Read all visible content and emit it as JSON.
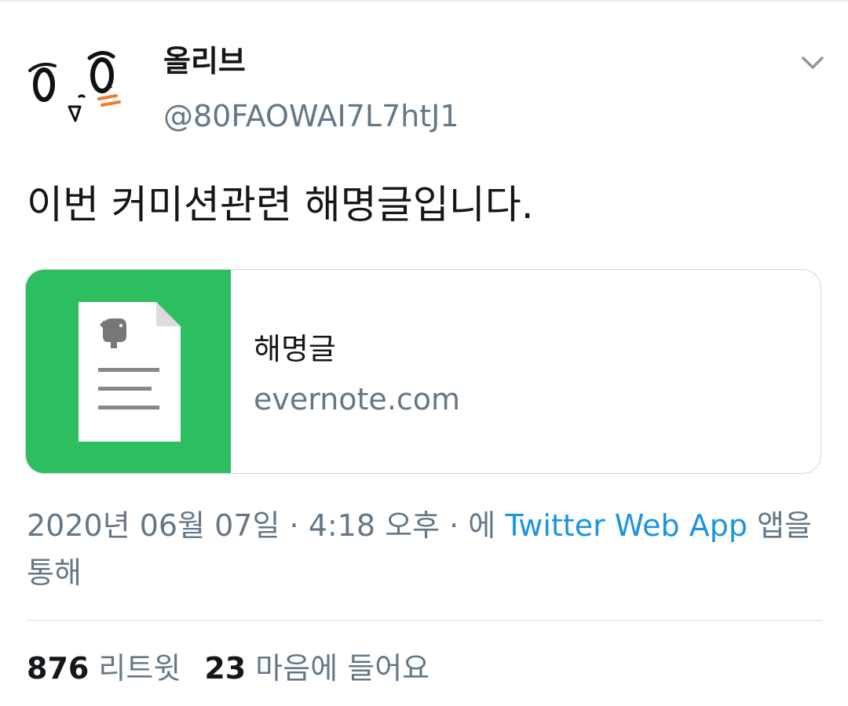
{
  "tweet": {
    "author": {
      "display_name": "올리브",
      "handle": "@80FAOWAI7L7htJ1"
    },
    "text": "이번 커미션관련 해명글입니다.",
    "card": {
      "title": "해명글",
      "domain": "evernote.com",
      "thumb_color": "#2dbe60",
      "thumb_icon": "evernote-document-icon"
    },
    "meta": {
      "date": "2020년 06월 07일",
      "separator": " · ",
      "time": "4:18 오후",
      "via_prefix": "에 ",
      "source": "Twitter Web App",
      "via_suffix": " 앱을 통해"
    },
    "stats": {
      "retweets_count": "876",
      "retweets_label": "리트윗",
      "likes_count": "23",
      "likes_label": "마음에 들어요"
    }
  },
  "colors": {
    "text_primary": "#14171a",
    "text_secondary": "#657786",
    "link": "#1b95e0",
    "border": "#ccd6dd"
  }
}
